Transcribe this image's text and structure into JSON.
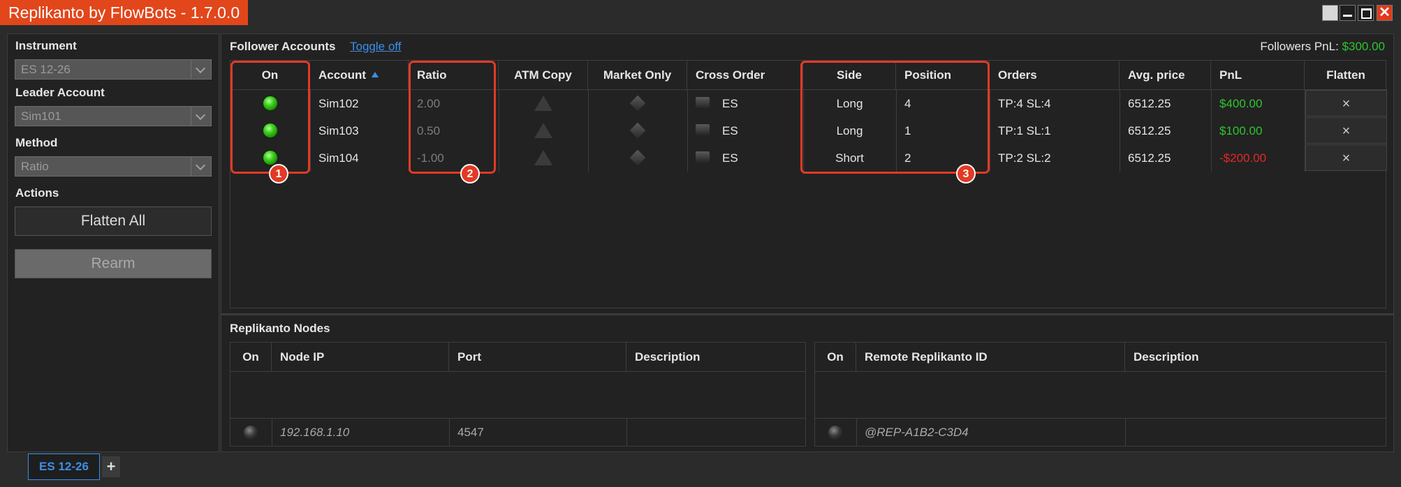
{
  "window": {
    "title": "Replikanto by FlowBots - 1.7.0.0"
  },
  "left": {
    "instrument_label": "Instrument",
    "instrument_value": "ES 12-26",
    "leader_label": "Leader Account",
    "leader_value": "Sim101",
    "method_label": "Method",
    "method_value": "Ratio",
    "actions_label": "Actions",
    "flatten_all": "Flatten All",
    "rearm": "Rearm"
  },
  "followers": {
    "title": "Follower Accounts",
    "toggle_link": "Toggle off",
    "pnl_label": "Followers PnL:",
    "pnl_value": "$300.00",
    "headers": {
      "on": "On",
      "account": "Account",
      "ratio": "Ratio",
      "atm": "ATM Copy",
      "market": "Market Only",
      "cross": "Cross Order",
      "side": "Side",
      "position": "Position",
      "orders": "Orders",
      "avg": "Avg. price",
      "pnl": "PnL",
      "flatten": "Flatten"
    },
    "rows": [
      {
        "account": "Sim102",
        "ratio": "2.00",
        "cross": "ES",
        "side": "Long",
        "position": "4",
        "orders": "TP:4 SL:4",
        "avg": "6512.25",
        "pnl": "$400.00",
        "flatten": "×"
      },
      {
        "account": "Sim103",
        "ratio": "0.50",
        "cross": "ES",
        "side": "Long",
        "position": "1",
        "orders": "TP:1 SL:1",
        "avg": "6512.25",
        "pnl": "$100.00",
        "flatten": "×"
      },
      {
        "account": "Sim104",
        "ratio": "-1.00",
        "cross": "ES",
        "side": "Short",
        "position": "2",
        "orders": "TP:2 SL:2",
        "avg": "6512.25",
        "pnl": "-$200.00",
        "flatten": "×"
      }
    ],
    "colors": {
      "positive": "#2ec52e",
      "negative": "#e22828",
      "highlight": "#e23a25"
    },
    "badges": [
      "1",
      "2",
      "3"
    ]
  },
  "nodes": {
    "title": "Replikanto Nodes",
    "left_headers": {
      "on": "On",
      "ip": "Node IP",
      "port": "Port",
      "desc": "Description"
    },
    "left_row": {
      "ip": "192.168.1.10",
      "port": "4547",
      "desc": ""
    },
    "right_headers": {
      "on": "On",
      "remote": "Remote Replikanto ID",
      "desc": "Description"
    },
    "right_row": {
      "remote": "@REP-A1B2-C3D4",
      "desc": ""
    }
  },
  "tabs": {
    "active": "ES 12-26",
    "add": "+"
  }
}
